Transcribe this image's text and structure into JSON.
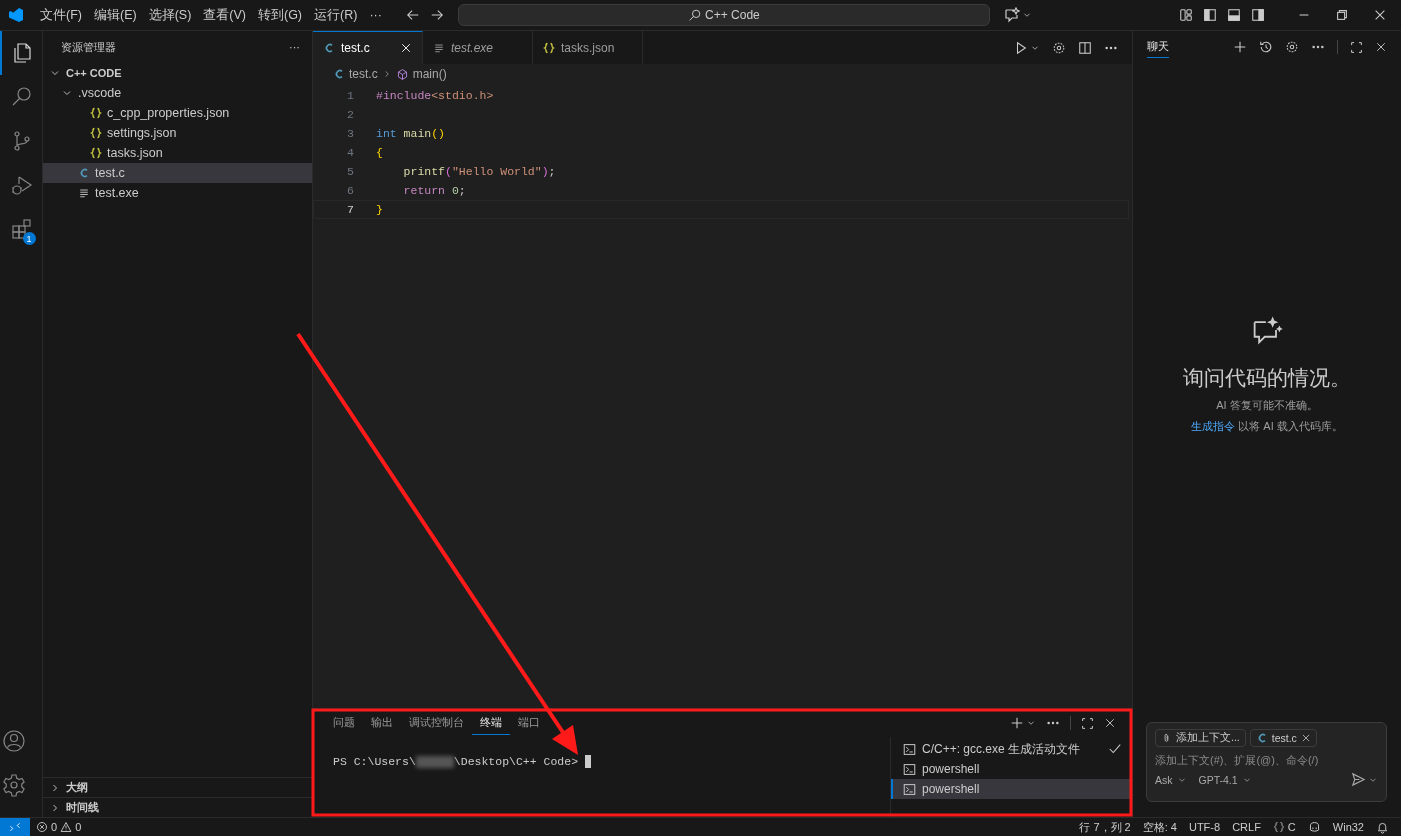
{
  "title_bar": {
    "menus": [
      "文件(F)",
      "编辑(E)",
      "选择(S)",
      "查看(V)",
      "转到(G)",
      "运行(R)"
    ],
    "more": "···",
    "search": "C++ Code"
  },
  "activity_bar": {
    "items": [
      {
        "kind": "explorer",
        "selected": true
      },
      {
        "kind": "search",
        "selected": false
      },
      {
        "kind": "source-control",
        "selected": false
      },
      {
        "kind": "run-debug",
        "selected": false
      },
      {
        "kind": "extensions",
        "selected": false,
        "badge": "1"
      }
    ]
  },
  "sidebar": {
    "title": "资源管理器",
    "more": "···",
    "tree": [
      {
        "label": "C++ CODE",
        "kind": "root",
        "expanded": true,
        "selected": false,
        "children": [
          {
            "label": ".vscode",
            "kind": "folder",
            "expanded": true,
            "selected": false,
            "children": [
              {
                "label": "c_cpp_properties.json",
                "kind": "json",
                "selected": false
              },
              {
                "label": "settings.json",
                "kind": "json",
                "selected": false
              },
              {
                "label": "tasks.json",
                "kind": "json",
                "selected": false
              }
            ]
          },
          {
            "label": "test.c",
            "kind": "c",
            "selected": true
          },
          {
            "label": "test.exe",
            "kind": "text",
            "selected": false
          }
        ]
      }
    ],
    "sections": [
      {
        "label": "大纲",
        "expanded": false
      },
      {
        "label": "时间线",
        "expanded": false
      }
    ]
  },
  "editor": {
    "tabs": [
      {
        "label": "test.c",
        "kind": "c",
        "selected": true,
        "preview": false
      },
      {
        "label": "test.exe",
        "kind": "text",
        "selected": false,
        "preview": true
      },
      {
        "label": "tasks.json",
        "kind": "json",
        "selected": false,
        "preview": false
      }
    ],
    "breadcrumbs": [
      {
        "label": "test.c",
        "kind": "c"
      },
      {
        "label": "main()",
        "kind": "symbol"
      }
    ],
    "lines": [
      {
        "number": "1",
        "current": false,
        "tokens": [
          {
            "text": "#include",
            "kind": "directive"
          },
          {
            "text": "<stdio.h>",
            "kind": "string"
          }
        ]
      },
      {
        "number": "2",
        "current": false
      },
      {
        "number": "3",
        "current": false,
        "tokens": [
          {
            "text": "int",
            "kind": "keyword"
          },
          {
            "text": "main",
            "kind": "function",
            "space": true
          },
          {
            "text": "()",
            "kind": "bracket1"
          }
        ]
      },
      {
        "number": "4",
        "current": false,
        "tokens": [
          {
            "text": "{",
            "kind": "bracket1"
          }
        ]
      },
      {
        "number": "5",
        "current": false,
        "indented": true,
        "tokens": [
          {
            "text": "printf",
            "kind": "function"
          },
          {
            "text": "(",
            "kind": "bracket2"
          },
          {
            "text": "\"Hello World\"",
            "kind": "string"
          },
          {
            "text": ")",
            "kind": "bracket2"
          },
          {
            "text": ";",
            "kind": "plain"
          }
        ]
      },
      {
        "number": "6",
        "current": false,
        "indented": true,
        "tokens": [
          {
            "text": "return",
            "kind": "control"
          },
          {
            "text": "0",
            "kind": "number",
            "space": true
          },
          {
            "text": ";",
            "kind": "plain"
          }
        ]
      },
      {
        "number": "7",
        "current": true,
        "tokens": [
          {
            "text": "}",
            "kind": "bracket1"
          }
        ]
      }
    ]
  },
  "panel": {
    "tabs": [
      {
        "label": "问题",
        "selected": false
      },
      {
        "label": "输出",
        "selected": false
      },
      {
        "label": "调试控制台",
        "selected": false
      },
      {
        "label": "终端",
        "selected": true
      },
      {
        "label": "端口",
        "selected": false
      }
    ],
    "terminal": {
      "prompt_start": "PS C:\\Users\\",
      "prompt_end": "\\Desktop\\C++ Code>"
    },
    "terminals": [
      {
        "label": "C/C++: gcc.exe 生成活动文件",
        "selected": false,
        "checked": true
      },
      {
        "label": "powershell",
        "selected": false,
        "checked": false
      },
      {
        "label": "powershell",
        "selected": true,
        "checked": false
      }
    ]
  },
  "chat": {
    "tabs": [
      {
        "label": "聊天",
        "selected": true
      }
    ],
    "heading": "询问代码的情况。",
    "note": "AI 答复可能不准确。",
    "link": "生成指令",
    "link_rest": " 以将 AI 载入代码库。",
    "chips": [
      {
        "label": "添加上下文...",
        "kind": "attach"
      },
      {
        "label": "test.c",
        "kind": "file"
      }
    ],
    "placeholder": "添加上下文(#)、扩展(@)、命令(/)",
    "mode": "Ask",
    "model": "GPT-4.1"
  },
  "status_bar": {
    "errors": "0",
    "warnings": "0",
    "position": "行 7，列 2",
    "indent": "空格: 4",
    "encoding": "UTF-8",
    "eol": "CRLF",
    "language": "C",
    "platform": "Win32"
  },
  "annotations": {
    "frame": true,
    "arrow": true
  }
}
